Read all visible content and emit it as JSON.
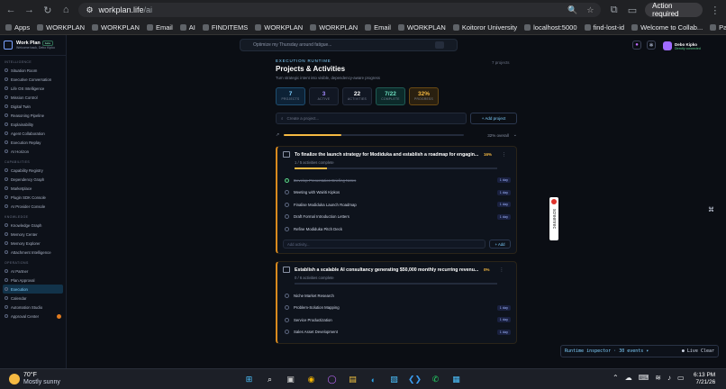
{
  "browser": {
    "url_host": "workplan.life",
    "url_path": "/ai",
    "action_required": "Action required"
  },
  "bookmarks": [
    "Apps",
    "WORKPLAN",
    "WORKPLAN",
    "Email",
    "AI",
    "FINDITEMS",
    "WORKPLAN",
    "WORKPLAN",
    "Email",
    "WORKPLAN",
    "Koitoror University",
    "localhost:5000",
    "find-lost-id",
    "Welcome to Collab...",
    "Payment Required"
  ],
  "sidebar": {
    "brand": "Work Plan",
    "brand_sub": "Welcome back, Debo Kipko",
    "beta": "beta",
    "sections": [
      {
        "title": "INTELLIGENCE",
        "items": [
          "Situation Room",
          "Executive Conversation",
          "Life OS Intelligence",
          "Mission Control",
          "Digital Twin",
          "Reasoning Pipeline",
          "Explainability",
          "Agent Collaboration",
          "Execution Replay",
          "AI Horizon"
        ]
      },
      {
        "title": "CAPABILITIES",
        "items": [
          "Capability Registry",
          "Dependency Graph",
          "Marketplace",
          "Plugin SDK Console",
          "AI Provider Console"
        ]
      },
      {
        "title": "KNOWLEDGE",
        "items": [
          "Knowledge Graph",
          "Memory Center",
          "Memory Explorer",
          "Attachment Intelligence"
        ]
      },
      {
        "title": "OPERATIONS",
        "items": [
          "AI Partner",
          "Plan Approval",
          "Execution",
          "Calendar",
          "Automation Studio",
          "Approval Center"
        ]
      }
    ],
    "active": "Execution"
  },
  "topbar": {
    "command_placeholder": "Optimize my Thursday around fatigue...",
    "user_name": "Debo Kipko",
    "user_status": "Directly connected"
  },
  "page": {
    "eyebrow": "EXECUTION RUNTIME",
    "title": "Projects & Activities",
    "subtitle": "Turn strategic intent into visible, dependency-aware progress",
    "count": "7 projects"
  },
  "stats": [
    {
      "n": "7",
      "l": "PROJECTS"
    },
    {
      "n": "3",
      "l": "ACTIVE"
    },
    {
      "n": "22",
      "l": "ACTIVITIES"
    },
    {
      "n": "7/22",
      "l": "COMPLETE"
    },
    {
      "n": "32%",
      "l": "PROGRESS"
    }
  ],
  "search": {
    "placeholder": "Create a project...",
    "add": "+ Add project"
  },
  "overall": {
    "label": "32% overall",
    "progress": 0.32
  },
  "projects": [
    {
      "title": "To finalize the launch strategy for Modiduka and establish a roadmap for engagin...",
      "pct": "16%",
      "progress": 0.16,
      "meta": "1 / 5 activities complete",
      "activities": [
        {
          "label": "Develop Presentation Briefing Notes",
          "done": true,
          "tag": "1 day"
        },
        {
          "label": "Meeting with Wairiti Kipkos",
          "done": false,
          "tag": "1 day"
        },
        {
          "label": "Finalise Modiduka Launch Roadmap",
          "done": false,
          "tag": "1 day"
        },
        {
          "label": "Draft Formal Introduction Letters",
          "done": false,
          "tag": "1 day"
        },
        {
          "label": "Refine Modiduka Pitch Deck",
          "done": false,
          "tag": ""
        }
      ],
      "add_placeholder": "Add activity...",
      "add_label": "+ Add"
    },
    {
      "title": "Establish a scalable AI consultancy generating $50,000 monthly recurring revenu...",
      "pct": "0%",
      "progress": 0,
      "meta": "0 / 6 activities complete",
      "activities": [
        {
          "label": "Niche Market Research",
          "done": false,
          "tag": ""
        },
        {
          "label": "Problem-Solution Mapping",
          "done": false,
          "tag": "1 day"
        },
        {
          "label": "Service Productization",
          "done": false,
          "tag": "1 day"
        },
        {
          "label": "Sales Asset Development",
          "done": false,
          "tag": "1 day"
        }
      ]
    }
  ],
  "inspector": {
    "label": "Runtime inspector · 30 events ▾",
    "live": "● Live  Clear"
  },
  "recorder": "screenrec",
  "taskbar": {
    "temp": "70°F",
    "weather": "Mostly sunny",
    "time": "6:13 PM",
    "date": "7/21/26"
  }
}
